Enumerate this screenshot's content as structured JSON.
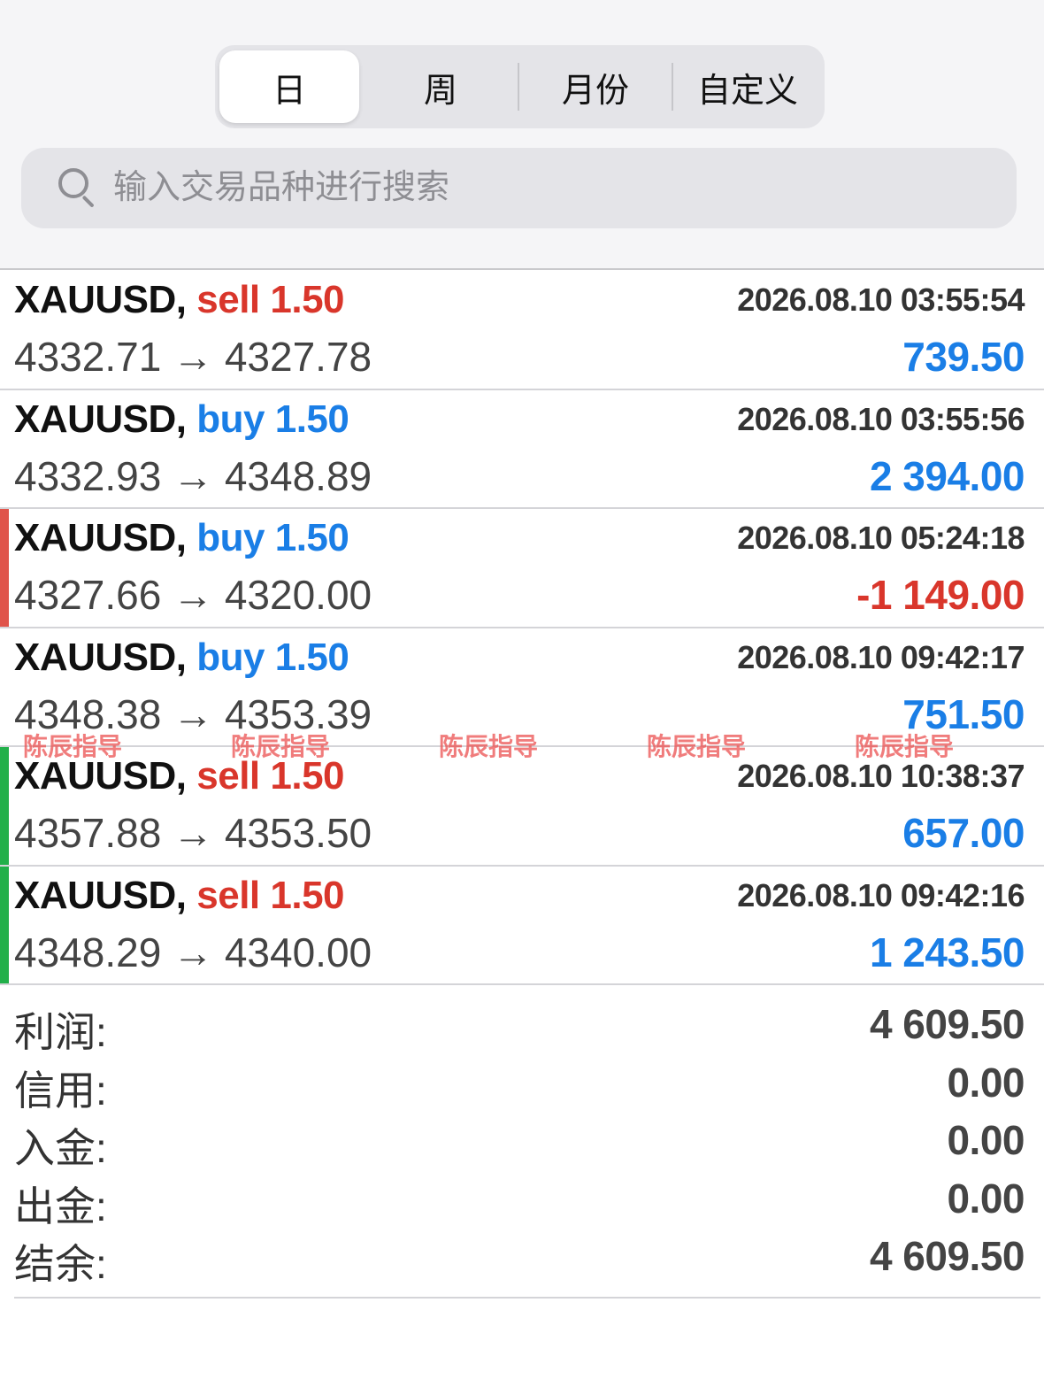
{
  "tabs": [
    {
      "label": "日",
      "active": true
    },
    {
      "label": "周",
      "active": false
    },
    {
      "label": "月份",
      "active": false
    },
    {
      "label": "自定义",
      "active": false
    }
  ],
  "search": {
    "placeholder": "输入交易品种进行搜索",
    "icon": "search-icon"
  },
  "trades": [
    {
      "symbol": "XAUUSD,",
      "side": "sell",
      "lot": "1.50",
      "time": "2026.08.10 03:55:54",
      "open": "4332.71",
      "arrow": "→",
      "close": "4327.78",
      "profit": "739.50",
      "bar": "none"
    },
    {
      "symbol": "XAUUSD,",
      "side": "buy",
      "lot": "1.50",
      "time": "2026.08.10 03:55:56",
      "open": "4332.93",
      "arrow": "→",
      "close": "4348.89",
      "profit": "2 394.00",
      "bar": "none"
    },
    {
      "symbol": "XAUUSD,",
      "side": "buy",
      "lot": "1.50",
      "time": "2026.08.10 05:24:18",
      "open": "4327.66",
      "arrow": "→",
      "close": "4320.00",
      "profit": "-1 149.00",
      "bar": "#e0544b"
    },
    {
      "symbol": "XAUUSD,",
      "side": "buy",
      "lot": "1.50",
      "time": "2026.08.10 09:42:17",
      "open": "4348.38",
      "arrow": "→",
      "close": "4353.39",
      "profit": "751.50",
      "bar": "none"
    },
    {
      "symbol": "XAUUSD,",
      "side": "sell",
      "lot": "1.50",
      "time": "2026.08.10 10:38:37",
      "open": "4357.88",
      "arrow": "→",
      "close": "4353.50",
      "profit": "657.00",
      "bar": "#22b04a"
    },
    {
      "symbol": "XAUUSD,",
      "side": "sell",
      "lot": "1.50",
      "time": "2026.08.10 09:42:16",
      "open": "4348.29",
      "arrow": "→",
      "close": "4340.00",
      "profit": "1 243.50",
      "bar": "#22b04a"
    }
  ],
  "watermark": "陈辰指导",
  "summary": [
    {
      "label": "利润:",
      "value": "4 609.50"
    },
    {
      "label": "信用:",
      "value": "0.00"
    },
    {
      "label": "入金:",
      "value": "0.00"
    },
    {
      "label": "出金:",
      "value": "0.00"
    },
    {
      "label": "结余:",
      "value": "4 609.50"
    }
  ],
  "colors": {
    "sell": "#d9362b",
    "buy": "#1a7ee6",
    "loss_bar": "#e0544b",
    "gain_bar": "#22b04a"
  }
}
